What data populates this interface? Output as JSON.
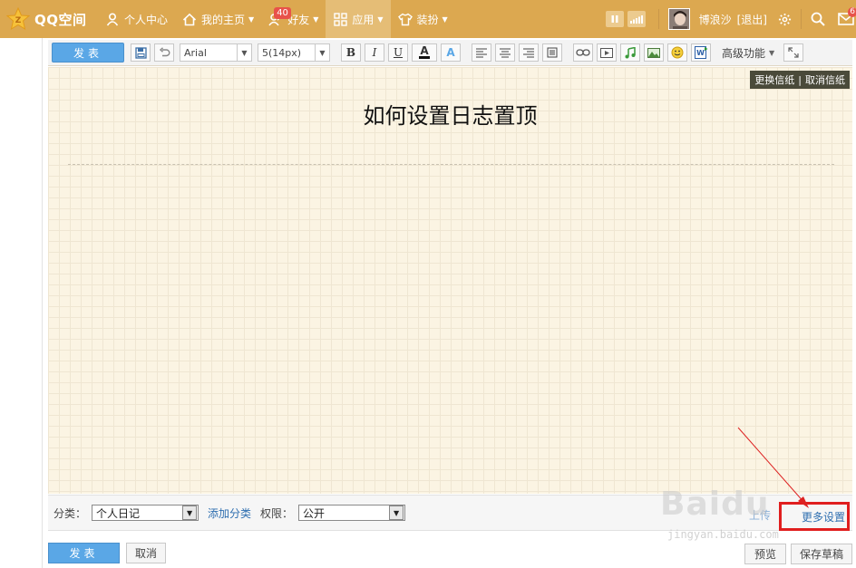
{
  "topbar": {
    "logo_text": "QQ空间",
    "nav": [
      {
        "label": "个人中心"
      },
      {
        "label": "我的主页"
      },
      {
        "label": "好友",
        "badge": "40"
      },
      {
        "label": "应用"
      },
      {
        "label": "装扮"
      }
    ],
    "user_name": "博浪沙",
    "logout": "[退出]",
    "mail_badge": "6"
  },
  "toolbar": {
    "publish_label": "发表",
    "font_family": "Arial",
    "font_size": "5(14px)",
    "bold": "B",
    "italic": "I",
    "underline": "U",
    "font_color": "A",
    "advanced": "高级功能"
  },
  "editor": {
    "title": "如何设置日志置顶",
    "change_paper": "更换信纸",
    "cancel_paper": "取消信纸"
  },
  "settings": {
    "category_label": "分类：",
    "category_value": "个人日记",
    "add_category": "添加分类",
    "permission_label": "权限：",
    "permission_value": "公开",
    "upload_label": "上传",
    "more_settings": "更多设置"
  },
  "bottom": {
    "publish": "发表",
    "cancel": "取消",
    "preview": "预览",
    "save_draft": "保存草稿"
  },
  "watermark": {
    "text": "Baidu",
    "sub": "jingyan.baidu.com"
  },
  "colors": {
    "topbar": "#dca850",
    "publish_blue": "#5aa7e6",
    "highlight_red": "#e01e1e"
  }
}
